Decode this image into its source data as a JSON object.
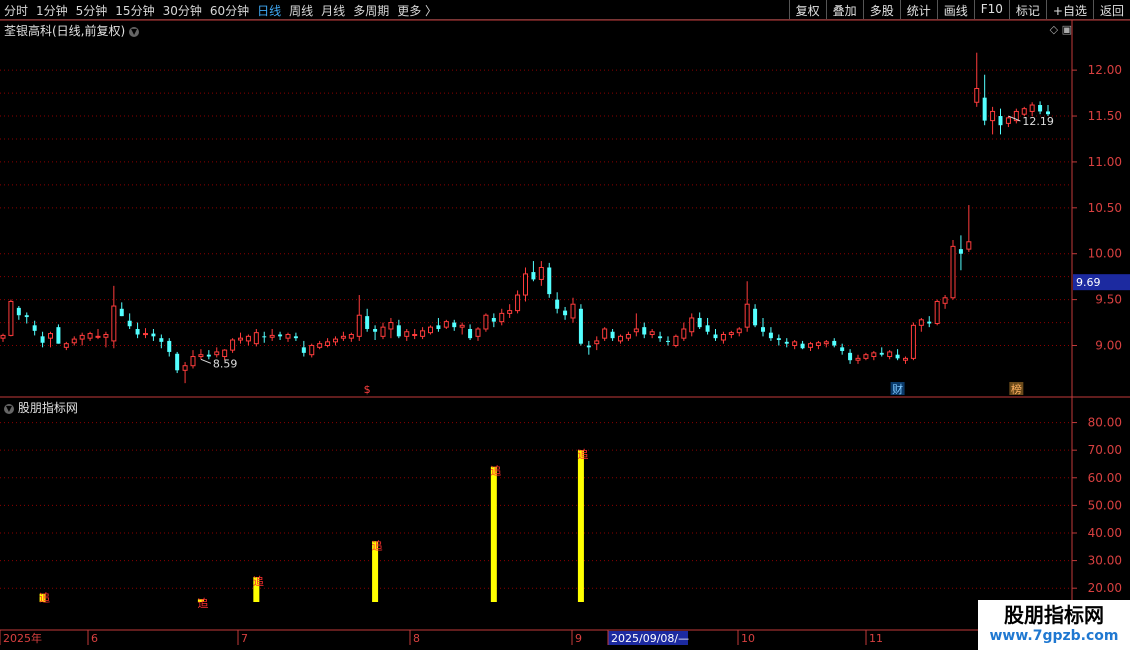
{
  "toolbar": {
    "periods": [
      "分时",
      "1分钟",
      "5分钟",
      "15分钟",
      "30分钟",
      "60分钟",
      "日线",
      "周线",
      "月线",
      "多周期",
      "更多 〉"
    ],
    "active_period": "日线",
    "buttons": [
      "复权",
      "叠加",
      "多股",
      "统计",
      "画线",
      "F10",
      "标记",
      "+自选",
      "返回"
    ]
  },
  "main_title": "荃银高科(日线,前复权)",
  "sub_title": "股朋指标网",
  "watermark": {
    "line1": "股朋指标网",
    "line2": "www.7gpzb.com"
  },
  "colors": {
    "up": "#ff3c3c",
    "down": "#54ffff",
    "grid": "#8b0000",
    "axis": "#c23a3a",
    "bar": "#ffff00",
    "marker": "#ff3030"
  },
  "chart_data": [
    {
      "type": "candlestick",
      "title": "荃银高科(日线,前复权)",
      "ylim": [
        8.45,
        12.35
      ],
      "y_ticks": [
        "12.00",
        "11.50",
        "11.00",
        "10.50",
        "10.00",
        "9.50",
        "9.00"
      ],
      "current_price_label": "9.69",
      "annotations": [
        {
          "text": "12.19",
          "kind": "high",
          "index": 127
        },
        {
          "text": "8.59",
          "kind": "low",
          "index": 25
        },
        {
          "text": "$",
          "kind": "event",
          "index": 46
        },
        {
          "text": "财",
          "kind": "event",
          "index": 113
        },
        {
          "text": "榜",
          "kind": "event",
          "index": 128
        }
      ],
      "x_labels": [
        "2025年",
        "6",
        "7",
        "8",
        "9",
        "2025/09/08/—",
        "10",
        "11"
      ],
      "ohlc": [
        [
          9.08,
          9.13,
          9.04,
          9.11
        ],
        [
          9.11,
          9.5,
          9.1,
          9.48
        ],
        [
          9.41,
          9.43,
          9.28,
          9.33
        ],
        [
          9.33,
          9.36,
          9.24,
          9.31
        ],
        [
          9.22,
          9.27,
          9.11,
          9.16
        ],
        [
          9.1,
          9.15,
          8.98,
          9.03
        ],
        [
          9.08,
          9.15,
          8.98,
          9.13
        ],
        [
          9.2,
          9.23,
          9.02,
          9.02
        ],
        [
          8.98,
          9.04,
          8.95,
          9.02
        ],
        [
          9.03,
          9.1,
          9.0,
          9.07
        ],
        [
          9.07,
          9.14,
          9.0,
          9.11
        ],
        [
          9.08,
          9.15,
          9.05,
          9.13
        ],
        [
          9.1,
          9.18,
          9.07,
          9.1
        ],
        [
          9.09,
          9.15,
          8.98,
          9.12
        ],
        [
          9.05,
          9.65,
          8.97,
          9.43
        ],
        [
          9.4,
          9.47,
          9.32,
          9.32
        ],
        [
          9.27,
          9.35,
          9.18,
          9.21
        ],
        [
          9.18,
          9.25,
          9.08,
          9.12
        ],
        [
          9.12,
          9.19,
          9.08,
          9.13
        ],
        [
          9.13,
          9.18,
          9.05,
          9.1
        ],
        [
          9.08,
          9.12,
          8.97,
          9.04
        ],
        [
          9.05,
          9.08,
          8.88,
          8.93
        ],
        [
          8.91,
          8.93,
          8.7,
          8.73
        ],
        [
          8.73,
          8.82,
          8.59,
          8.78
        ],
        [
          8.78,
          8.95,
          8.75,
          8.88
        ],
        [
          8.88,
          8.96,
          8.85,
          8.9
        ],
        [
          8.9,
          8.95,
          8.85,
          8.88
        ],
        [
          8.9,
          8.98,
          8.87,
          8.93
        ],
        [
          8.88,
          8.96,
          8.84,
          8.95
        ],
        [
          8.95,
          9.08,
          8.92,
          9.06
        ],
        [
          9.06,
          9.14,
          9.02,
          9.08
        ],
        [
          9.05,
          9.12,
          9.0,
          9.1
        ],
        [
          9.02,
          9.18,
          8.99,
          9.14
        ],
        [
          9.1,
          9.15,
          9.03,
          9.09
        ],
        [
          9.09,
          9.18,
          9.05,
          9.11
        ],
        [
          9.12,
          9.15,
          9.06,
          9.1
        ],
        [
          9.08,
          9.14,
          9.04,
          9.12
        ],
        [
          9.1,
          9.14,
          9.05,
          9.08
        ],
        [
          8.98,
          9.05,
          8.88,
          8.92
        ],
        [
          8.9,
          9.02,
          8.87,
          9.0
        ],
        [
          8.98,
          9.05,
          8.96,
          9.02
        ],
        [
          9.0,
          9.08,
          8.98,
          9.04
        ],
        [
          9.04,
          9.1,
          9.0,
          9.07
        ],
        [
          9.08,
          9.15,
          9.05,
          9.1
        ],
        [
          9.08,
          9.14,
          9.04,
          9.12
        ],
        [
          9.1,
          9.55,
          9.05,
          9.33
        ],
        [
          9.32,
          9.4,
          9.15,
          9.18
        ],
        [
          9.18,
          9.22,
          9.06,
          9.15
        ],
        [
          9.1,
          9.25,
          9.07,
          9.2
        ],
        [
          9.18,
          9.3,
          9.08,
          9.25
        ],
        [
          9.22,
          9.28,
          9.08,
          9.1
        ],
        [
          9.1,
          9.18,
          9.05,
          9.15
        ],
        [
          9.12,
          9.18,
          9.07,
          9.12
        ],
        [
          9.1,
          9.2,
          9.07,
          9.16
        ],
        [
          9.14,
          9.22,
          9.12,
          9.2
        ],
        [
          9.22,
          9.3,
          9.15,
          9.18
        ],
        [
          9.2,
          9.28,
          9.18,
          9.26
        ],
        [
          9.25,
          9.28,
          9.16,
          9.2
        ],
        [
          9.2,
          9.25,
          9.12,
          9.22
        ],
        [
          9.18,
          9.23,
          9.06,
          9.08
        ],
        [
          9.1,
          9.2,
          9.05,
          9.18
        ],
        [
          9.18,
          9.35,
          9.15,
          9.33
        ],
        [
          9.3,
          9.35,
          9.2,
          9.26
        ],
        [
          9.26,
          9.4,
          9.22,
          9.35
        ],
        [
          9.35,
          9.45,
          9.3,
          9.38
        ],
        [
          9.38,
          9.6,
          9.35,
          9.55
        ],
        [
          9.55,
          9.85,
          9.48,
          9.78
        ],
        [
          9.8,
          9.92,
          9.7,
          9.72
        ],
        [
          9.72,
          9.92,
          9.65,
          9.85
        ],
        [
          9.85,
          9.9,
          9.52,
          9.56
        ],
        [
          9.5,
          9.58,
          9.35,
          9.4
        ],
        [
          9.38,
          9.42,
          9.28,
          9.33
        ],
        [
          9.3,
          9.52,
          9.25,
          9.45
        ],
        [
          9.4,
          9.45,
          9.0,
          9.02
        ],
        [
          9.0,
          9.05,
          8.9,
          8.98
        ],
        [
          9.02,
          9.1,
          8.95,
          9.05
        ],
        [
          9.08,
          9.2,
          9.05,
          9.18
        ],
        [
          9.15,
          9.18,
          9.05,
          9.08
        ],
        [
          9.05,
          9.12,
          9.02,
          9.1
        ],
        [
          9.08,
          9.15,
          9.05,
          9.12
        ],
        [
          9.15,
          9.35,
          9.1,
          9.18
        ],
        [
          9.2,
          9.25,
          9.08,
          9.12
        ],
        [
          9.12,
          9.18,
          9.08,
          9.15
        ],
        [
          9.1,
          9.15,
          9.04,
          9.08
        ],
        [
          9.05,
          9.1,
          9.0,
          9.04
        ],
        [
          9.0,
          9.12,
          8.98,
          9.1
        ],
        [
          9.08,
          9.25,
          9.05,
          9.18
        ],
        [
          9.15,
          9.35,
          9.1,
          9.3
        ],
        [
          9.3,
          9.36,
          9.18,
          9.2
        ],
        [
          9.22,
          9.3,
          9.12,
          9.15
        ],
        [
          9.12,
          9.18,
          9.05,
          9.08
        ],
        [
          9.06,
          9.15,
          9.02,
          9.12
        ],
        [
          9.12,
          9.16,
          9.08,
          9.14
        ],
        [
          9.14,
          9.2,
          9.1,
          9.18
        ],
        [
          9.2,
          9.7,
          9.15,
          9.45
        ],
        [
          9.4,
          9.45,
          9.2,
          9.22
        ],
        [
          9.2,
          9.3,
          9.1,
          9.15
        ],
        [
          9.14,
          9.2,
          9.05,
          9.08
        ],
        [
          9.08,
          9.12,
          9.0,
          9.06
        ],
        [
          9.04,
          9.08,
          8.98,
          9.02
        ],
        [
          9.0,
          9.06,
          8.96,
          9.04
        ],
        [
          9.02,
          9.05,
          8.96,
          8.97
        ],
        [
          8.98,
          9.04,
          8.94,
          9.02
        ],
        [
          9.0,
          9.05,
          8.96,
          9.03
        ],
        [
          9.02,
          9.06,
          8.98,
          9.04
        ],
        [
          9.05,
          9.08,
          8.98,
          9.0
        ],
        [
          8.98,
          9.02,
          8.9,
          8.94
        ],
        [
          8.92,
          8.96,
          8.8,
          8.84
        ],
        [
          8.84,
          8.9,
          8.8,
          8.86
        ],
        [
          8.86,
          8.92,
          8.84,
          8.9
        ],
        [
          8.88,
          8.94,
          8.84,
          8.92
        ],
        [
          8.92,
          8.98,
          8.88,
          8.9
        ],
        [
          8.88,
          8.95,
          8.85,
          8.93
        ],
        [
          8.9,
          8.96,
          8.84,
          8.86
        ],
        [
          8.84,
          8.88,
          8.8,
          8.86
        ],
        [
          8.86,
          9.25,
          8.84,
          9.22
        ],
        [
          9.22,
          9.3,
          9.15,
          9.28
        ],
        [
          9.26,
          9.32,
          9.2,
          9.24
        ],
        [
          9.24,
          9.5,
          9.22,
          9.48
        ],
        [
          9.46,
          9.55,
          9.4,
          9.52
        ],
        [
          9.52,
          10.15,
          9.5,
          10.08
        ],
        [
          10.05,
          10.2,
          9.82,
          10.0
        ],
        [
          10.05,
          10.53,
          10.02,
          10.13
        ],
        [
          11.65,
          12.19,
          11.6,
          11.8
        ],
        [
          11.7,
          11.95,
          11.4,
          11.45
        ],
        [
          11.45,
          11.6,
          11.3,
          11.55
        ],
        [
          11.5,
          11.58,
          11.3,
          11.4
        ],
        [
          11.42,
          11.5,
          11.38,
          11.48
        ],
        [
          11.45,
          11.58,
          11.42,
          11.55
        ],
        [
          11.52,
          11.6,
          11.5,
          11.58
        ],
        [
          11.55,
          11.65,
          11.5,
          11.62
        ],
        [
          11.62,
          11.66,
          11.52,
          11.55
        ],
        [
          11.55,
          11.62,
          11.5,
          11.52
        ]
      ]
    },
    {
      "type": "bar",
      "title": "股朋指标网",
      "ylim": [
        15,
        86
      ],
      "y_ticks": [
        "80.00",
        "70.00",
        "60.00",
        "50.00",
        "40.00",
        "30.00",
        "20.00"
      ],
      "bar_label": "追",
      "bars": [
        {
          "index": 5,
          "value": 18
        },
        {
          "index": 25,
          "value": 16
        },
        {
          "index": 32,
          "value": 24
        },
        {
          "index": 47,
          "value": 37
        },
        {
          "index": 62,
          "value": 64
        },
        {
          "index": 73,
          "value": 70
        }
      ]
    }
  ]
}
